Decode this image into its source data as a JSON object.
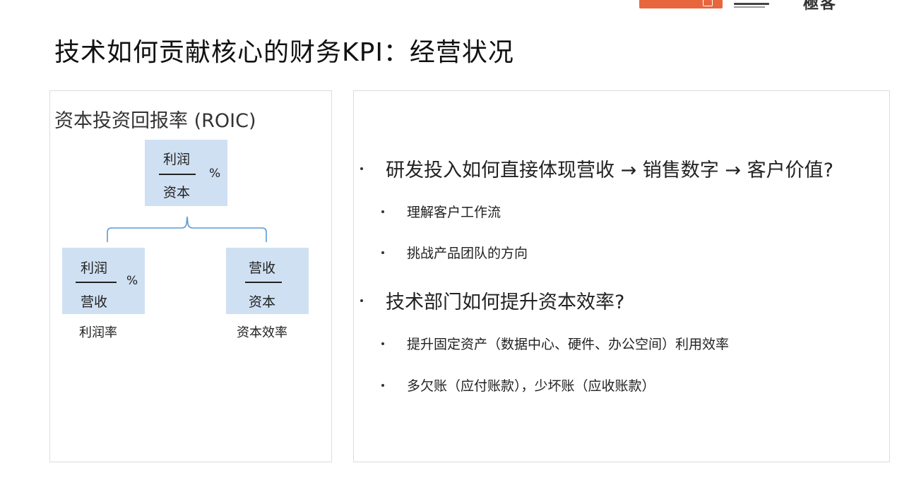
{
  "slide": {
    "title": "技术如何贡献核心的财务KPI：经营状况"
  },
  "left_panel": {
    "heading": "资本投资回报率 (ROIC)",
    "top_box": {
      "numerator": "利润",
      "denominator": "资本",
      "suffix": "%"
    },
    "left_box": {
      "numerator": "利润",
      "denominator": "营收",
      "suffix": "%",
      "caption": "利润率"
    },
    "right_box": {
      "numerator": "营收",
      "denominator": "资本",
      "caption": "资本效率"
    }
  },
  "right_panel": {
    "q1": "研发投入如何直接体现营收 → 销售数字 → 客户价值?",
    "q1_points": [
      "理解客户工作流",
      "挑战产品团队的方向"
    ],
    "q2": "技术部门如何提升资本效率?",
    "q2_points": [
      "提升固定资产（数据中心、硬件、办公空间）利用效率",
      "多欠账（应付账款），少坏账（应收账款）"
    ]
  },
  "brand": {
    "accent": "#e8663d",
    "text": "極客"
  },
  "colors": {
    "box_fill": "#cfe0f3",
    "brace": "#5b9bd5",
    "panel_border": "#dcdcdc"
  }
}
